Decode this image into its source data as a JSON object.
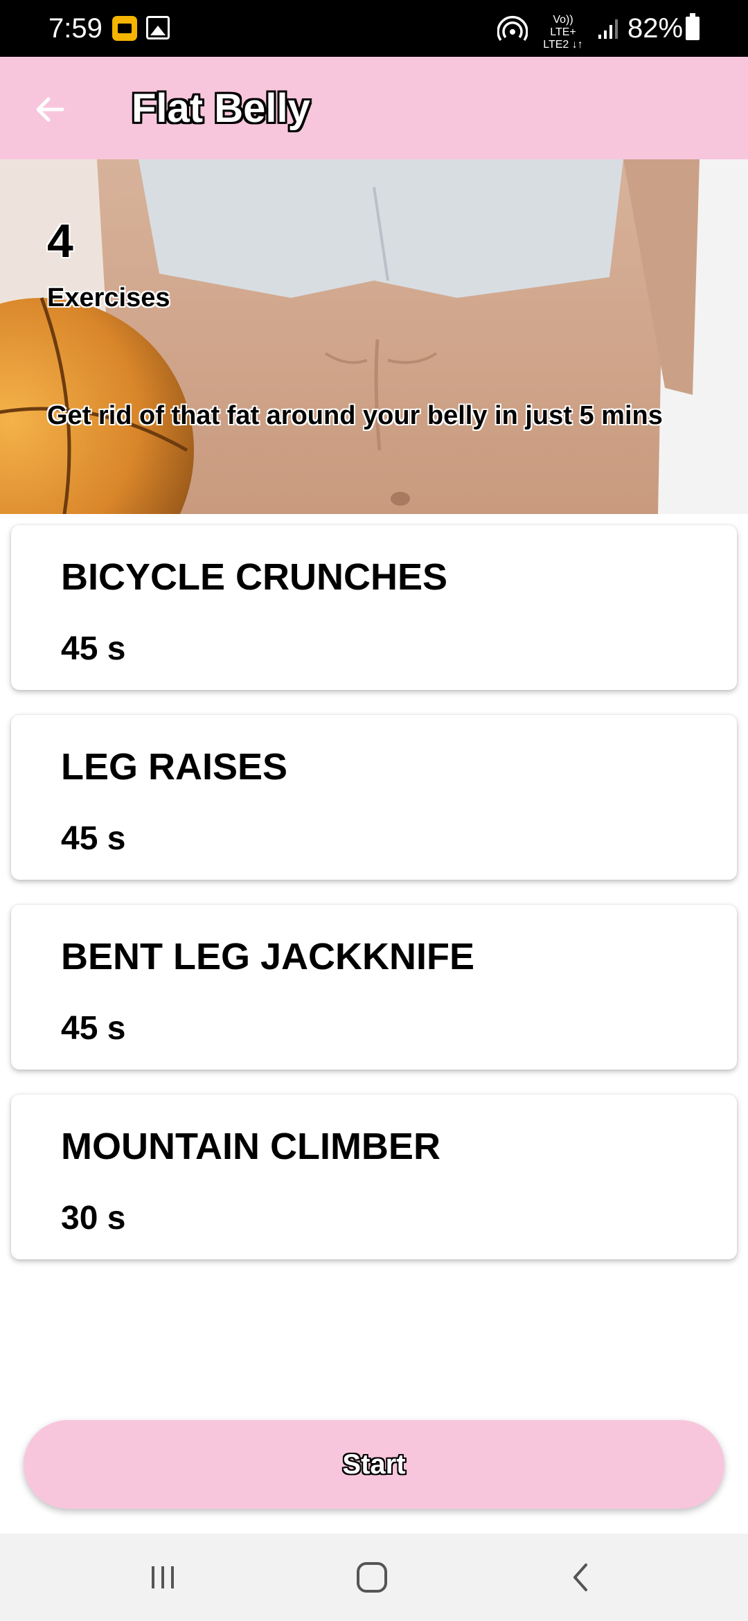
{
  "status_bar": {
    "time": "7:59",
    "network_line1": "Vo)) LTE+",
    "network_line2": "LTE2 ↓↑",
    "battery": "82%",
    "icons": [
      "app-notification-icon",
      "gallery-icon",
      "hotspot-icon",
      "signal-icon",
      "battery-icon"
    ]
  },
  "app_bar": {
    "title": "Flat Belly",
    "back_icon": "arrow-left-icon",
    "background_color": "#f8c6dc"
  },
  "hero": {
    "exercise_count": "4",
    "exercise_count_label": "Exercises",
    "description": "Get rid of that fat around your belly in just 5 mins"
  },
  "exercises": [
    {
      "name": "BICYCLE CRUNCHES",
      "duration": "45 s"
    },
    {
      "name": "LEG RAISES",
      "duration": "45 s"
    },
    {
      "name": "BENT LEG JACKKNIFE",
      "duration": "45 s"
    },
    {
      "name": "MOUNTAIN CLIMBER",
      "duration": "30 s"
    }
  ],
  "start_button": {
    "label": "Start",
    "color": "#f8c6dc"
  },
  "nav_bar": {
    "icons": [
      "recent-apps-icon",
      "home-icon",
      "back-icon"
    ]
  }
}
